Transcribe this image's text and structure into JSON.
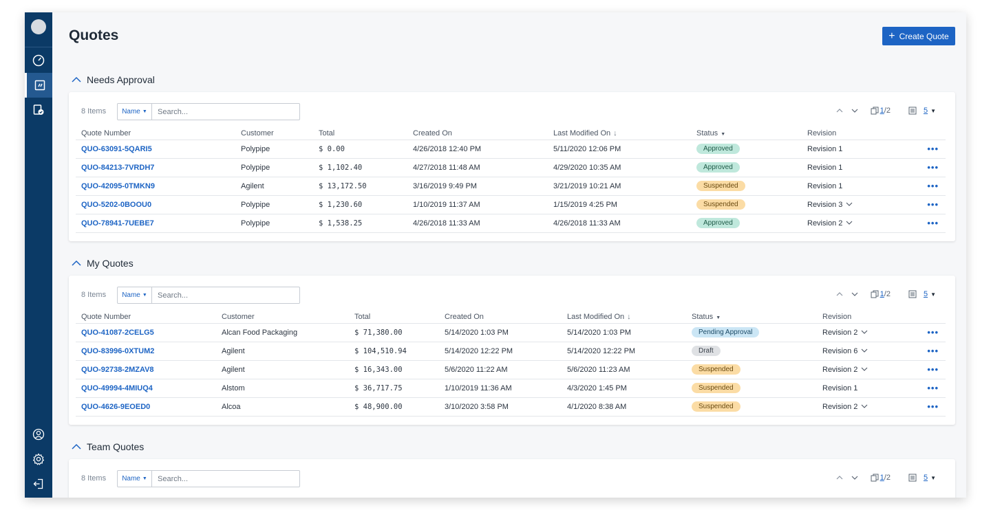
{
  "page": {
    "title": "Quotes",
    "create_label": "Create Quote"
  },
  "sidebar": {
    "items": [
      {
        "icon": "dashboard-icon"
      },
      {
        "icon": "quotes-icon",
        "active": true
      },
      {
        "icon": "approvals-icon"
      },
      {
        "icon": "user-icon"
      },
      {
        "icon": "settings-icon"
      },
      {
        "icon": "logout-icon"
      }
    ]
  },
  "sections": [
    {
      "title": "Needs Approval",
      "items_count": "8 Items",
      "filter_label": "Name",
      "search_placeholder": "Search...",
      "page_current": "1",
      "page_total": "/2",
      "page_size": "5",
      "columns": [
        "Quote Number",
        "Customer",
        "Total",
        "Created On",
        "Last Modified On",
        "Status",
        "Revision"
      ],
      "rows": [
        {
          "number": "QUO-63091-5QARI5",
          "customer": "Polypipe",
          "total": "$ 0.00",
          "created": "4/26/2018 12:40 PM",
          "modified": "5/11/2020 12:06 PM",
          "status": "Approved",
          "revision": "Revision 1"
        },
        {
          "number": "QUO-84213-7VRDH7",
          "customer": "Polypipe",
          "total": "$ 1,102.40",
          "created": "4/27/2018 11:48 AM",
          "modified": "4/29/2020 10:35 AM",
          "status": "Approved",
          "revision": "Revision 1"
        },
        {
          "number": "QUO-42095-0TMKN9",
          "customer": "Agilent",
          "total": "$ 13,172.50",
          "created": "3/16/2019 9:49 PM",
          "modified": "3/21/2019 10:21 AM",
          "status": "Suspended",
          "revision": "Revision 1"
        },
        {
          "number": "QUO-5202-0BOOU0",
          "customer": "Polypipe",
          "total": "$ 1,230.60",
          "created": "1/10/2019 11:37 AM",
          "modified": "1/15/2019 4:25 PM",
          "status": "Suspended",
          "revision": "Revision 3"
        },
        {
          "number": "QUO-78941-7UEBE7",
          "customer": "Polypipe",
          "total": "$ 1,538.25",
          "created": "4/26/2018 11:33 AM",
          "modified": "4/26/2018 11:33 AM",
          "status": "Approved",
          "revision": "Revision 2"
        }
      ]
    },
    {
      "title": "My Quotes",
      "items_count": "8 Items",
      "filter_label": "Name",
      "search_placeholder": "Search...",
      "page_current": "1",
      "page_total": "/2",
      "page_size": "5",
      "columns": [
        "Quote Number",
        "Customer",
        "Total",
        "Created On",
        "Last Modified On",
        "Status",
        "Revision"
      ],
      "rows": [
        {
          "number": "QUO-41087-2CELG5",
          "customer": "Alcan Food Packaging",
          "total": "$ 71,380.00",
          "created": "5/14/2020 1:03 PM",
          "modified": "5/14/2020 1:03 PM",
          "status": "Pending Approval",
          "revision": "Revision 2"
        },
        {
          "number": "QUO-83996-0XTUM2",
          "customer": "Agilent",
          "total": "$ 104,510.94",
          "created": "5/14/2020 12:22 PM",
          "modified": "5/14/2020 12:22 PM",
          "status": "Draft",
          "revision": "Revision 6"
        },
        {
          "number": "QUO-92738-2MZAV8",
          "customer": "Agilent",
          "total": "$ 16,343.00",
          "created": "5/6/2020 11:22 AM",
          "modified": "5/6/2020 11:23 AM",
          "status": "Suspended",
          "revision": "Revision 2"
        },
        {
          "number": "QUO-49994-4MIUQ4",
          "customer": "Alstom",
          "total": "$ 36,717.75",
          "created": "1/10/2019 11:36 AM",
          "modified": "4/3/2020 1:45 PM",
          "status": "Suspended",
          "revision": "Revision 1"
        },
        {
          "number": "QUO-4626-9EOED0",
          "customer": "Alcoa",
          "total": "$ 48,900.00",
          "created": "3/10/2020 3:58 PM",
          "modified": "4/1/2020 8:38 AM",
          "status": "Suspended",
          "revision": "Revision 2"
        }
      ]
    },
    {
      "title": "Team Quotes",
      "items_count": "8 Items",
      "filter_label": "Name",
      "search_placeholder": "Search...",
      "page_current": "1",
      "page_total": "/2",
      "page_size": "5"
    }
  ]
}
